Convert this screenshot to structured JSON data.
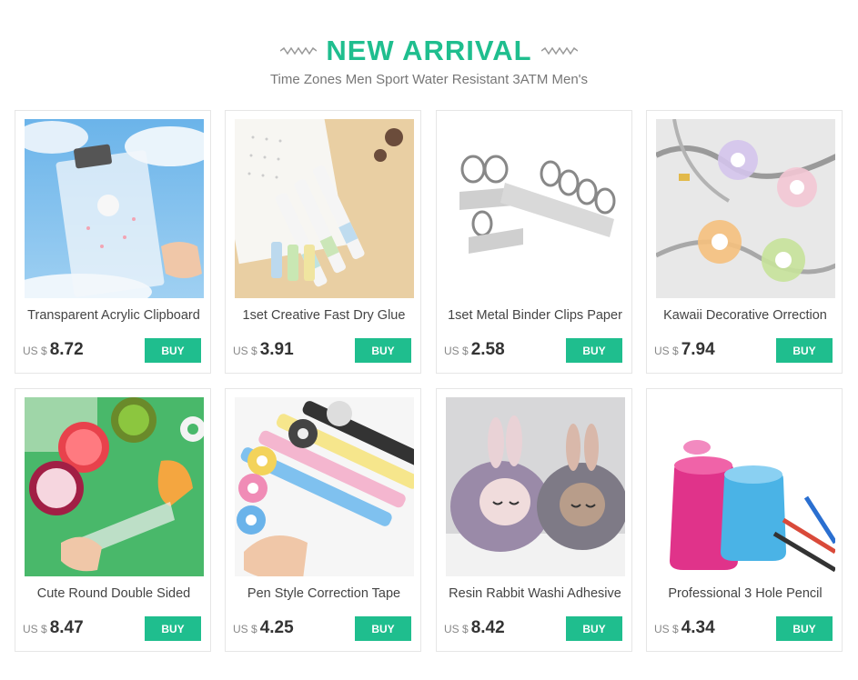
{
  "header": {
    "title": "NEW ARRIVAL",
    "subtitle": "Time Zones Men Sport Water Resistant 3ATM Men's"
  },
  "colors": {
    "accent": "#1fbe8e"
  },
  "products": [
    {
      "name": "Transparent Acrylic Clipboard",
      "currency": "US $",
      "price": "8.72",
      "buy_label": "BUY"
    },
    {
      "name": "1set Creative Fast Dry Glue",
      "currency": "US $",
      "price": "3.91",
      "buy_label": "BUY"
    },
    {
      "name": "1set Metal Binder Clips Paper",
      "currency": "US $",
      "price": "2.58",
      "buy_label": "BUY"
    },
    {
      "name": "Kawaii Decorative Orrection",
      "currency": "US $",
      "price": "7.94",
      "buy_label": "BUY"
    },
    {
      "name": "Cute Round Double Sided",
      "currency": "US $",
      "price": "8.47",
      "buy_label": "BUY"
    },
    {
      "name": "Pen Style Correction Tape",
      "currency": "US $",
      "price": "4.25",
      "buy_label": "BUY"
    },
    {
      "name": "Resin Rabbit Washi Adhesive",
      "currency": "US $",
      "price": "8.42",
      "buy_label": "BUY"
    },
    {
      "name": "Professional 3 Hole Pencil",
      "currency": "US $",
      "price": "4.34",
      "buy_label": "BUY"
    }
  ]
}
